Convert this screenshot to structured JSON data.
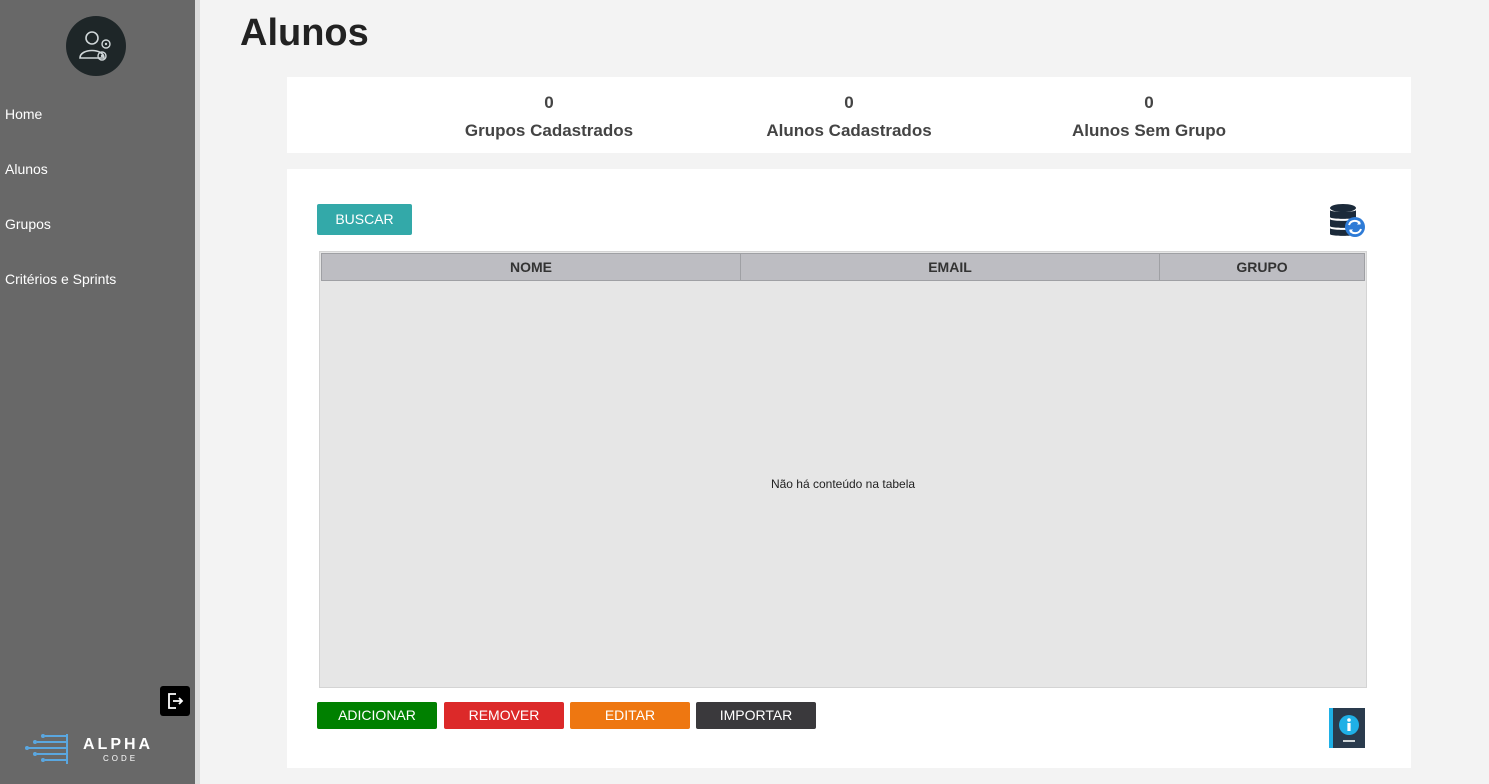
{
  "sidebar": {
    "items": [
      {
        "label": "Home"
      },
      {
        "label": "Alunos"
      },
      {
        "label": "Grupos"
      },
      {
        "label": "Critérios e Sprints"
      }
    ],
    "logo": {
      "name": "ALPHA",
      "sub": "CODE"
    }
  },
  "page": {
    "title": "Alunos"
  },
  "stats": [
    {
      "value": "0",
      "label": "Grupos Cadastrados"
    },
    {
      "value": "0",
      "label": "Alunos Cadastrados"
    },
    {
      "value": "0",
      "label": "Alunos Sem Grupo"
    }
  ],
  "toolbar": {
    "search_label": "BUSCAR"
  },
  "table": {
    "columns": [
      "NOME",
      "EMAIL",
      "GRUPO"
    ],
    "rows": [],
    "empty_message": "Não há conteúdo na tabela"
  },
  "actions": {
    "add_label": "ADICIONAR",
    "remove_label": "REMOVER",
    "edit_label": "EDITAR",
    "import_label": "IMPORTAR"
  },
  "colors": {
    "sidebar": "#686868",
    "search": "#33a9a9",
    "add": "#008000",
    "remove": "#dc2929",
    "edit": "#ee7711",
    "import": "#3a393c"
  }
}
